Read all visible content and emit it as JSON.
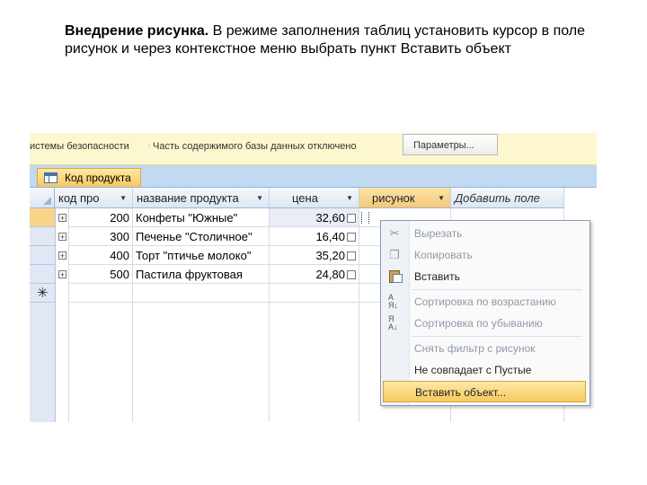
{
  "slide": {
    "title_bold": "Внедрение рисунка.",
    "body": " В режиме заполнения таблиц установить курсор в поле рисунок и через контекстное меню выбрать пункт Вставить объект"
  },
  "msgbar": {
    "security_label": "истемы безопасности",
    "message": "Часть содержимого базы данных отключено",
    "options_button": "Параметры..."
  },
  "tab": {
    "label": "Код продукта"
  },
  "columns": [
    {
      "label": "код про",
      "dropdown": true
    },
    {
      "label": "название продукта",
      "dropdown": true
    },
    {
      "label": "цена",
      "dropdown": true
    },
    {
      "label": "рисунок",
      "dropdown": true
    },
    {
      "label": "Добавить поле",
      "dropdown": false
    }
  ],
  "rows": [
    {
      "code": "200",
      "name": "Конфеты \"Южные\"",
      "price": "32,60"
    },
    {
      "code": "300",
      "name": "Печенье \"Столичное\"",
      "price": "16,40"
    },
    {
      "code": "400",
      "name": "Торт \"птичье молоко\"",
      "price": "35,20"
    },
    {
      "code": "500",
      "name": "Пастила фруктовая",
      "price": "24,80"
    }
  ],
  "context_menu": {
    "cut": "Вырезать",
    "copy": "Копировать",
    "paste": "Вставить",
    "sort_asc": "Сортировка по возрастанию",
    "sort_desc": "Сортировка по убыванию",
    "clear_filter": "Снять фильтр с рисунок",
    "not_empty": "Не совпадает с Пустые",
    "insert_object": "Вставить объект..."
  },
  "icons": {
    "cut": "scissors-icon",
    "copy": "copy-icon",
    "paste": "clipboard-icon",
    "sort_asc": "sort-a-z-icon",
    "sort_desc": "sort-z-a-icon"
  },
  "colors": {
    "message_bar": "#fdf7d0",
    "active_tab": "#f8c760",
    "highlight": "#f7c960",
    "header": "#dde6f1"
  }
}
